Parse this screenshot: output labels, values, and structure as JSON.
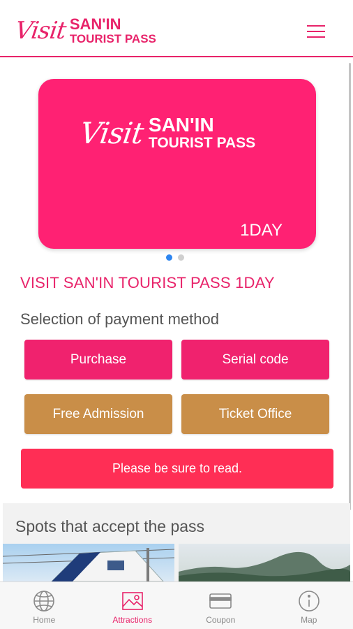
{
  "header": {
    "logo_visit": "Visit",
    "logo_line1": "SAN'IN",
    "logo_line2": "TOURIST PASS",
    "menu_icon": "hamburger-menu-icon"
  },
  "card": {
    "logo_visit": "Visit",
    "logo_line1": "SAN'IN",
    "logo_line2": "TOURIST PASS",
    "label": "1DAY",
    "color": "#ff2173"
  },
  "carousel": {
    "pages": 2,
    "active_index": 0
  },
  "pass_title": "VISIT SAN'IN TOURIST PASS 1DAY",
  "payment": {
    "heading": "Selection of payment method",
    "purchase": "Purchase",
    "serial_code": "Serial code",
    "free_admission": "Free Admission",
    "ticket_office": "Ticket Office",
    "read_notice": "Please be sure to read."
  },
  "spots": {
    "heading": "Spots that accept the pass"
  },
  "tabs": [
    {
      "label": "Home",
      "icon": "globe-icon"
    },
    {
      "label": "Attractions",
      "icon": "image-icon",
      "active": true
    },
    {
      "label": "Coupon",
      "icon": "card-icon"
    },
    {
      "label": "Map",
      "icon": "info-icon"
    }
  ],
  "colors": {
    "accent": "#e8236a",
    "gold": "#c98e48",
    "notice": "#ff2e55"
  }
}
